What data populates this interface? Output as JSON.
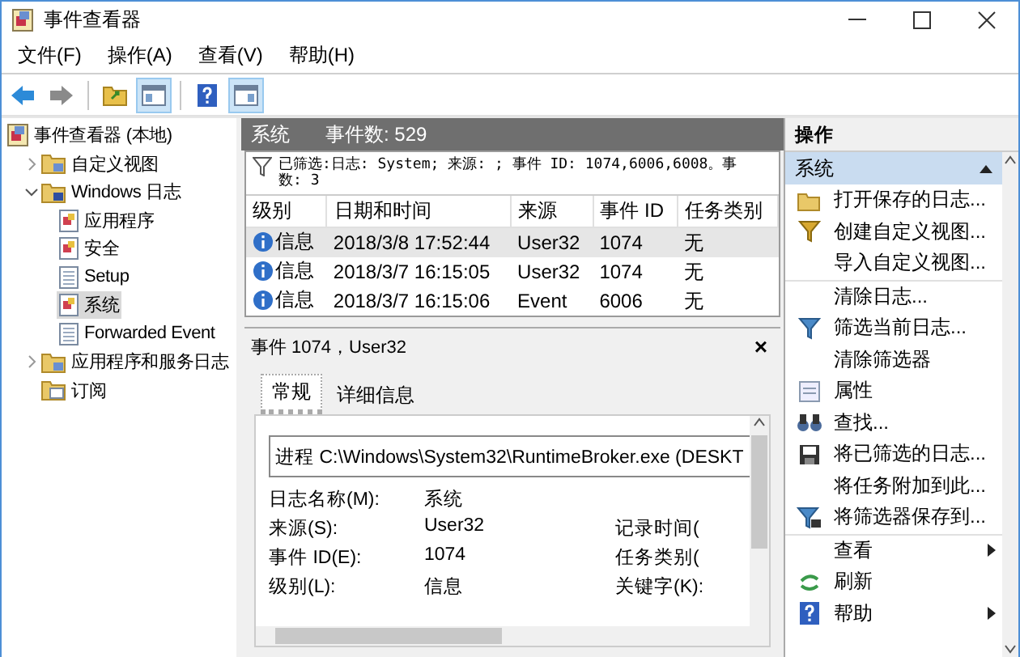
{
  "window": {
    "title": "事件查看器"
  },
  "menu": [
    "文件(F)",
    "操作(A)",
    "查看(V)",
    "帮助(H)"
  ],
  "toolbar": [
    {
      "kind": "back",
      "pressed": false
    },
    {
      "kind": "forward",
      "pressed": false
    },
    {
      "kind": "separator"
    },
    {
      "kind": "folder",
      "pressed": false
    },
    {
      "kind": "panel-left",
      "pressed": true
    },
    {
      "kind": "separator"
    },
    {
      "kind": "help",
      "pressed": false
    },
    {
      "kind": "panel-right",
      "pressed": true
    }
  ],
  "tree": [
    {
      "label": "事件查看器 (本地)",
      "kind": "root",
      "selected": false,
      "children": [
        {
          "label": "自定义视图",
          "kind": "folder",
          "selected": false,
          "expanded": false
        },
        {
          "label": "Windows 日志",
          "kind": "folder-log",
          "selected": false,
          "expanded": true,
          "children": [
            {
              "label": "应用程序",
              "kind": "log",
              "selected": false
            },
            {
              "label": "安全",
              "kind": "log",
              "selected": false
            },
            {
              "label": "Setup",
              "kind": "plain-log",
              "selected": false
            },
            {
              "label": "系统",
              "kind": "log",
              "selected": true
            },
            {
              "label": "Forwarded Event",
              "kind": "plain-log",
              "selected": false
            }
          ]
        },
        {
          "label": "应用程序和服务日志",
          "kind": "folder",
          "selected": false,
          "expanded": false
        },
        {
          "label": "订阅",
          "kind": "subscription",
          "selected": false
        }
      ]
    }
  ],
  "center": {
    "title": "系统",
    "count": "事件数: 529",
    "filter": [
      "已筛选:日志: System; 来源: ; 事件 ID: 1074,6006,6008。事",
      "数: 3"
    ],
    "table": {
      "columns": [
        "级别",
        "日期和时间",
        "来源",
        "事件 ID",
        "任务类别"
      ],
      "rows": [
        {
          "cells": [
            "信息",
            "2018/3/8 17:52:44",
            "User32",
            "1074",
            "无"
          ],
          "selected": true
        },
        {
          "cells": [
            "信息",
            "2018/3/7 16:15:05",
            "User32",
            "1074",
            "无"
          ],
          "selected": false
        },
        {
          "cells": [
            "信息",
            "2018/3/7 16:15:06",
            "Event",
            "6006",
            "无"
          ],
          "selected": false
        }
      ]
    },
    "detail": {
      "title": "事件 1074，User32",
      "close": "×",
      "tabs": [
        {
          "label": "常规",
          "selected": true
        },
        {
          "label": "详细信息",
          "selected": false
        }
      ],
      "message": "进程 C:\\Windows\\System32\\RuntimeBroker.exe (DESKT",
      "fields": [
        {
          "label": "日志名称(M):",
          "value": "系统"
        },
        {
          "label": "来源(S):",
          "value": "User32",
          "right_label": "记录时间("
        },
        {
          "label": "事件 ID(E):",
          "value": "1074",
          "right_label": "任务类别("
        },
        {
          "label": "级别(L):",
          "value": "信息",
          "right_label": "关键字(K):"
        }
      ]
    }
  },
  "actions": {
    "title": "操作",
    "section": {
      "label": "系统",
      "expanded": true
    },
    "items": [
      {
        "label": "打开保存的日志...",
        "kind": "open",
        "separator_before": false,
        "submenu": false
      },
      {
        "label": "创建自定义视图...",
        "kind": "filter-gold",
        "separator_before": false,
        "submenu": false
      },
      {
        "label": "导入自定义视图...",
        "kind": "plain",
        "separator_before": false,
        "submenu": false
      },
      {
        "label": "清除日志...",
        "kind": "plain",
        "separator_before": true,
        "submenu": false
      },
      {
        "label": "筛选当前日志...",
        "kind": "filter",
        "separator_before": false,
        "submenu": false
      },
      {
        "label": "清除筛选器",
        "kind": "plain",
        "separator_before": false,
        "submenu": false
      },
      {
        "label": "属性",
        "kind": "properties",
        "separator_before": false,
        "submenu": false
      },
      {
        "label": "查找...",
        "kind": "find",
        "separator_before": false,
        "submenu": false
      },
      {
        "label": "将已筛选的日志...",
        "kind": "save",
        "separator_before": false,
        "submenu": false
      },
      {
        "label": "将任务附加到此...",
        "kind": "plain",
        "separator_before": false,
        "submenu": false
      },
      {
        "label": "将筛选器保存到...",
        "kind": "filter-save",
        "separator_before": false,
        "submenu": false
      },
      {
        "label": "查看",
        "kind": "plain",
        "separator_before": true,
        "submenu": true
      },
      {
        "label": "刷新",
        "kind": "refresh",
        "separator_before": false,
        "submenu": false
      },
      {
        "label": "帮助",
        "kind": "help",
        "separator_before": false,
        "submenu": true
      }
    ]
  }
}
